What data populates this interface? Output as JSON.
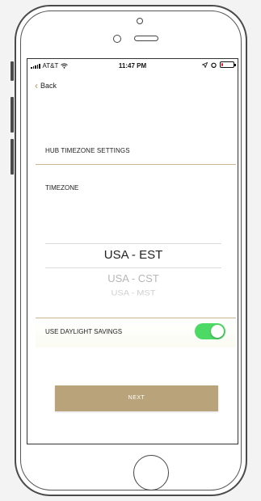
{
  "status_bar": {
    "carrier": "AT&T",
    "time": "11:47 PM",
    "battery_level_percent": 15
  },
  "nav": {
    "back_label": "Back"
  },
  "section_title": "HUB TIMEZONE SETTINGS",
  "timezone": {
    "label": "TIMEZONE",
    "selected": "USA - EST",
    "options_below": [
      "USA - CST",
      "USA - MST"
    ]
  },
  "daylight_savings": {
    "label": "USE DAYLIGHT SAVINGS",
    "enabled": true
  },
  "next_button_label": "NEXT",
  "colors": {
    "accent_gold": "#b8a37a",
    "toggle_on": "#4cd964",
    "battery_low": "#e02020"
  }
}
